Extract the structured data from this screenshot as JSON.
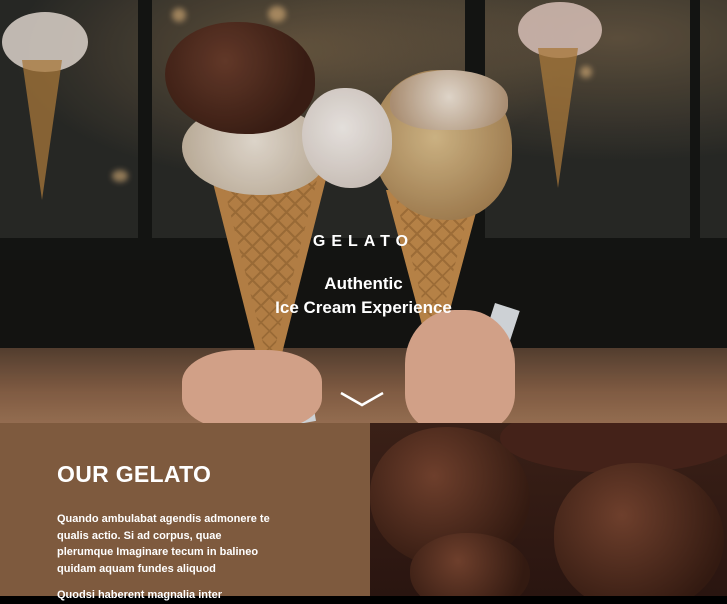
{
  "hero": {
    "brand": "GELATO",
    "tagline_line1": "Authentic",
    "tagline_line2": "Ice Cream Experience",
    "scroll_icon": "chevron-down-icon"
  },
  "about": {
    "title": "OUR GELATO",
    "paragraph1": "Quando ambulabat agendis admonere te qualis actio. Si ad corpus, quae plerumque Imaginare tecum in balineo quidam aquam fundes aliquod",
    "paragraph2": "Quodsi haberent magnalia inter"
  },
  "colors": {
    "about_bg": "#7e5a3e",
    "text": "#ffffff"
  }
}
